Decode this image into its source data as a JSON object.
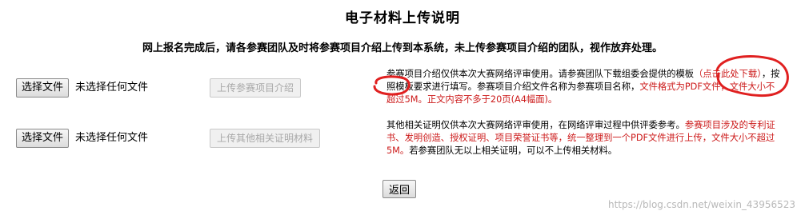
{
  "page": {
    "title": "电子材料上传说明",
    "notice": "网上报名完成后，请各参赛团队及时将参赛项目介绍上传到本系统，未上传参赛项目介绍的团队，视作放弃处理。"
  },
  "rows": [
    {
      "choose_label": "选择文件",
      "file_status": "未选择任何文件",
      "upload_label": "上传参赛项目介绍",
      "desc_part1": "参赛项目介绍仅供本次大赛网络评审使用。请参赛团队下载组委会提供的模板",
      "desc_link": "（点击此处下载）",
      "desc_part2": "，按照模板要求进行填写。参赛项目介绍文件名称为参赛项目名称，",
      "desc_red": "文件格式为PDF文件，文件大小不超过5M。正文内容不多于20页(A4幅面)。"
    },
    {
      "choose_label": "选择文件",
      "file_status": "未选择任何文件",
      "upload_label": "上传其他相关证明材料",
      "desc_part1": "其他相关证明仅供本次大赛网络评审使用，在网络评审过程中供评委参考。",
      "desc_red": "参赛项目涉及的专利证书、发明创造、授权证明、项目荣誉证书等，统一整理到一个PDF文件进行上传，文件大小不超过5M。",
      "desc_part2": "若参赛团队无以上相关证明，可以不上传相关材料。"
    }
  ],
  "back_label": "返回",
  "watermark": "https://blog.csdn.net/weixin_43956523",
  "colors": {
    "red_text": "#cc1a1a",
    "annotation": "#e02020"
  }
}
